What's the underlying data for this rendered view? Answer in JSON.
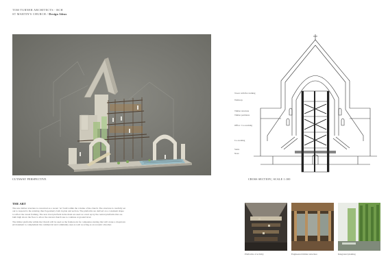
{
  "header": {
    "line1": "TOM TURNER ARCHITECTS - RCH",
    "line2": "ST MARTIN'S CHURCH /",
    "line3": "Design Ideas"
  },
  "perspective": {
    "caption": "CUTAWAY PERSPECTIVE"
  },
  "section": {
    "caption": "CROSS SECTION | SCALE 1:100",
    "labels": [
      "Tower with fire training",
      "Walkway",
      "Timber structure",
      "Timber partitions",
      "Office / Co-working",
      "Co-working",
      "Stairs",
      "Nave"
    ]
  },
  "the_art": {
    "title": "THE ART",
    "paragraph1": "The new timber structure is conceived as a recent ‘art’ built within the volume of the church. The structure is carefully set out to respond to the existing church geometry both in plan and section. The platforms are derived on a consistent shape to reflect the vessel framing. The new level platform in the main are used as a start up by the central platforms that are built high above the floor to allow the current church use to continue at ground level.",
    "paragraph2": "The timber platforms within the Church will be used as the framework for companies starting that will create a dropdown environment to complement the commercial and community uses as well as acting as an acoustic absorber."
  },
  "photos": [
    {
      "caption": "Platforms of activity"
    },
    {
      "caption": "Engineered timber structure"
    },
    {
      "caption": "Integrated planting"
    }
  ]
}
